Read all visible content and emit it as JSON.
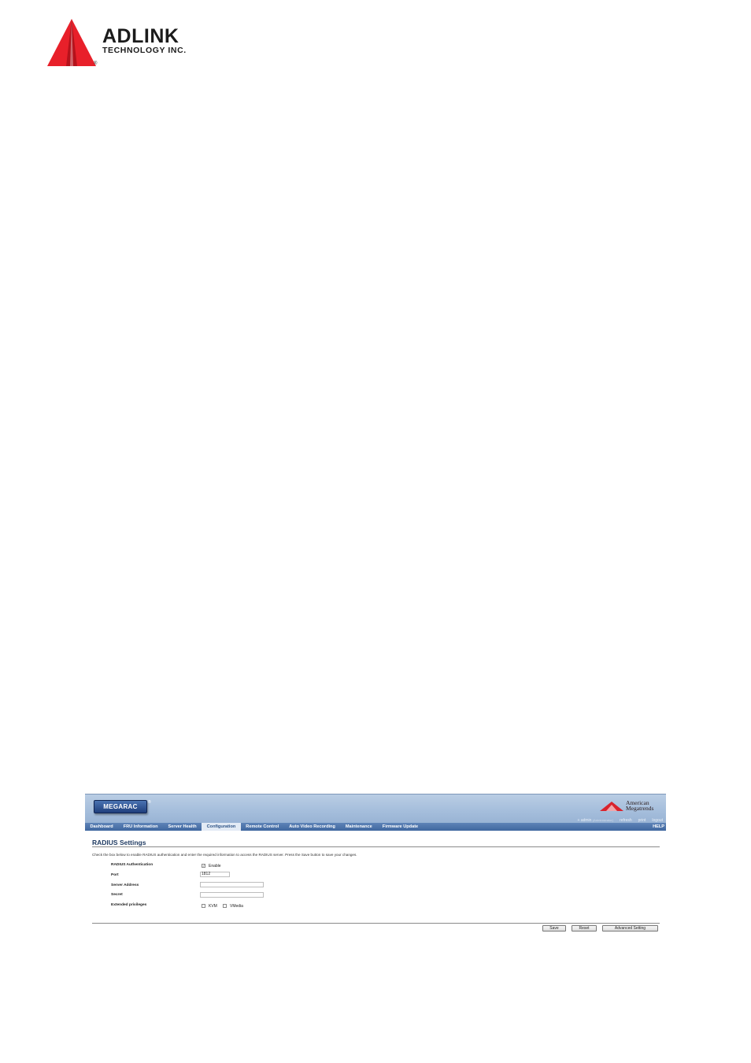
{
  "logo": {
    "name": "ADLINK",
    "subtitle": "TECHNOLOGY INC.",
    "registered": "®",
    "color": "#e8202a"
  },
  "app": {
    "brand": "MEGARAC",
    "brand_reg": "®",
    "vendor_line1": "American",
    "vendor_line2": "Megatrends",
    "user_bar": {
      "user": "+ admin",
      "role": "(Administrator)",
      "refresh": "refresh",
      "print": "print",
      "logout": "logout"
    },
    "nav": [
      {
        "label": "Dashboard",
        "active": false
      },
      {
        "label": "FRU Information",
        "active": false
      },
      {
        "label": "Server Health",
        "active": false
      },
      {
        "label": "Configuration",
        "active": true
      },
      {
        "label": "Remote Control",
        "active": false
      },
      {
        "label": "Auto Video Recording",
        "active": false
      },
      {
        "label": "Maintenance",
        "active": false
      },
      {
        "label": "Firmware Update",
        "active": false
      }
    ],
    "help": "HELP",
    "page_title": "RADIUS Settings",
    "description": "Check the box below to enable RADIUS authentication and enter the required information to access the RADIUS server. Press the Save button to save your changes.",
    "form": {
      "radius_auth_label": "RADIUS Authentication",
      "enable_label": "Enable",
      "enable_checked": true,
      "port_label": "Port",
      "port_value": "1812",
      "server_address_label": "Server Address",
      "server_address_value": "",
      "secret_label": "Secret",
      "secret_value": "",
      "ext_priv_label": "Extended privileges",
      "kvm_label": "KVM",
      "kvm_checked": false,
      "vmedia_label": "VMedia",
      "vmedia_checked": false
    },
    "buttons": {
      "save": "Save",
      "reset": "Reset",
      "advanced": "Advanced Setting"
    }
  }
}
